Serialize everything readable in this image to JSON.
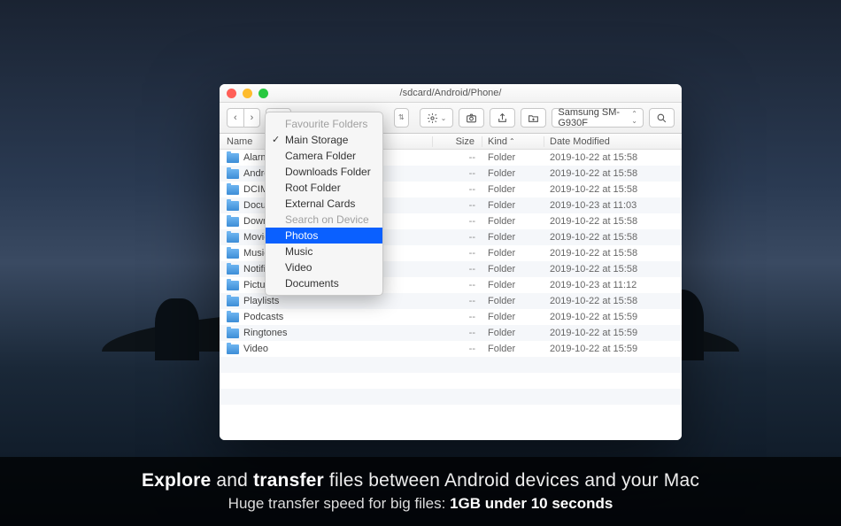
{
  "window": {
    "title": "/sdcard/Android/Phone/",
    "device_label": "Samsung SM-G930F"
  },
  "columns": {
    "name": "Name",
    "size": "Size",
    "kind": "Kind",
    "date": "Date Modified"
  },
  "rows": [
    {
      "name": "Alarms",
      "size": "--",
      "kind": "Folder",
      "date": "2019-10-22 at 15:58"
    },
    {
      "name": "Android",
      "size": "--",
      "kind": "Folder",
      "date": "2019-10-22 at 15:58"
    },
    {
      "name": "DCIM",
      "size": "--",
      "kind": "Folder",
      "date": "2019-10-22 at 15:58"
    },
    {
      "name": "Documents",
      "size": "--",
      "kind": "Folder",
      "date": "2019-10-23 at 11:03"
    },
    {
      "name": "Downloads",
      "size": "--",
      "kind": "Folder",
      "date": "2019-10-22 at 15:58"
    },
    {
      "name": "Movies",
      "size": "--",
      "kind": "Folder",
      "date": "2019-10-22 at 15:58"
    },
    {
      "name": "Music",
      "size": "--",
      "kind": "Folder",
      "date": "2019-10-22 at 15:58"
    },
    {
      "name": "Notifications",
      "size": "--",
      "kind": "Folder",
      "date": "2019-10-22 at 15:58"
    },
    {
      "name": "Pictures",
      "size": "--",
      "kind": "Folder",
      "date": "2019-10-23 at 11:12"
    },
    {
      "name": "Playlists",
      "size": "--",
      "kind": "Folder",
      "date": "2019-10-22 at 15:58"
    },
    {
      "name": "Podcasts",
      "size": "--",
      "kind": "Folder",
      "date": "2019-10-22 at 15:59"
    },
    {
      "name": "Ringtones",
      "size": "--",
      "kind": "Folder",
      "date": "2019-10-22 at 15:59"
    },
    {
      "name": "Video",
      "size": "--",
      "kind": "Folder",
      "date": "2019-10-22 at 15:59"
    }
  ],
  "dropdown": {
    "heading1": "Favourite Folders",
    "items1": [
      {
        "label": "Main Storage",
        "checked": true
      },
      {
        "label": "Camera Folder",
        "checked": false
      },
      {
        "label": "Downloads Folder",
        "checked": false
      },
      {
        "label": "Root Folder",
        "checked": false
      },
      {
        "label": "External Cards",
        "checked": false
      }
    ],
    "heading2": "Search on Device",
    "items2": [
      {
        "label": "Photos",
        "selected": true
      },
      {
        "label": "Music"
      },
      {
        "label": "Video"
      },
      {
        "label": "Documents"
      }
    ]
  },
  "caption": {
    "line1_a": "Explore",
    "line1_b": " and ",
    "line1_c": "transfer",
    "line1_d": " files between Android devices and your Mac",
    "line2_a": "Huge transfer speed for big files: ",
    "line2_b": "1GB under 10 seconds"
  }
}
